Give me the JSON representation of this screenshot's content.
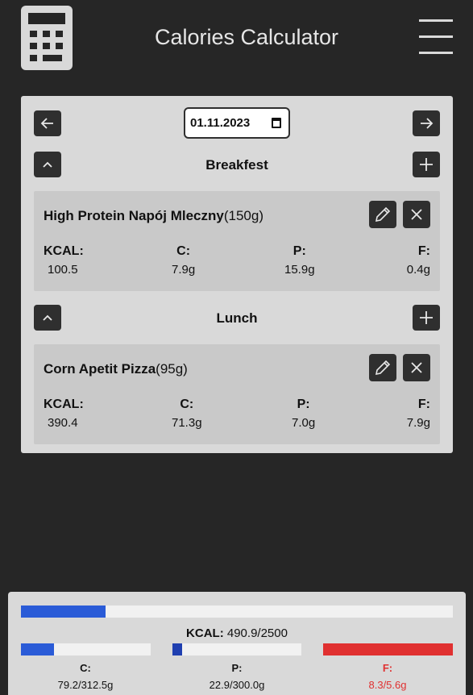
{
  "header": {
    "title": "Calories Calculator",
    "logo_icon": "calculator-icon",
    "menu_icon": "hamburger-menu-icon"
  },
  "date": {
    "value": "01.11.2023",
    "prev_icon": "arrow-left-icon",
    "next_icon": "arrow-right-icon"
  },
  "meals": [
    {
      "title": "Breakfest",
      "entries": [
        {
          "name": "High Protein Napój Mleczny",
          "portion": "(150g)",
          "kcal_label": "KCAL:",
          "kcal": "100.5",
          "c_label": "C:",
          "c": "7.9g",
          "p_label": "P:",
          "p": "15.9g",
          "f_label": "F:",
          "f": "0.4g"
        }
      ]
    },
    {
      "title": "Lunch",
      "entries": [
        {
          "name": "Corn Apetit Pizza",
          "portion": "(95g)",
          "kcal_label": "KCAL:",
          "kcal": "390.4",
          "c_label": "C:",
          "c": "71.3g",
          "p_label": "P:",
          "p": "7.0g",
          "f_label": "F:",
          "f": "7.9g"
        }
      ]
    }
  ],
  "summary": {
    "kcal_label": "KCAL:",
    "kcal_value": "490.9/2500",
    "kcal_fraction": 0.196,
    "c_label": "C:",
    "c_value": "79.2/312.5g",
    "c_fraction": 0.253,
    "p_label": "P:",
    "p_value": "22.9/300.0g",
    "p_fraction": 0.076,
    "f_label": "F:",
    "f_value": "8.3/5.6g",
    "f_fraction": 1.0
  },
  "colors": {
    "progress": "#2a5bd7",
    "protein": "#1f3fb0",
    "over": "#e03030",
    "background": "#262626",
    "card": "#d9d9d9"
  }
}
